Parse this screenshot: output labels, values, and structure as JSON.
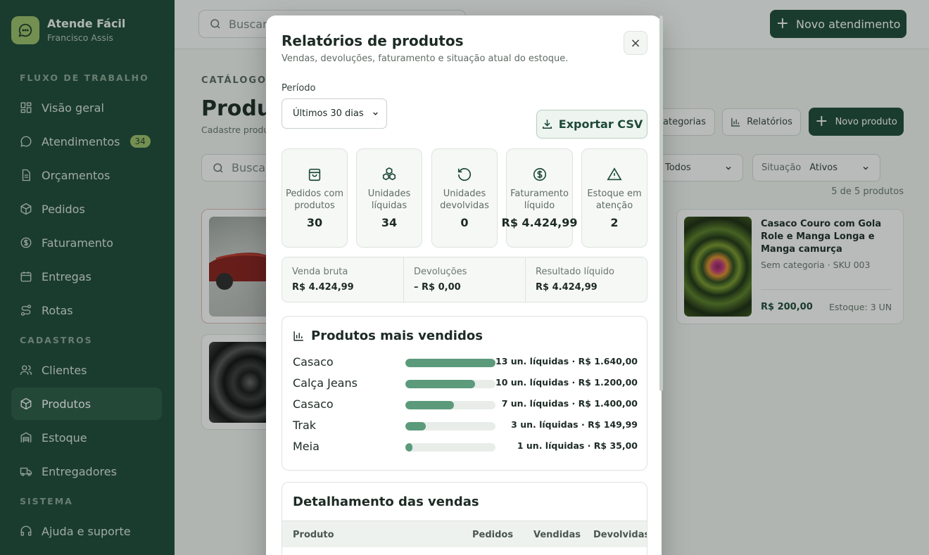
{
  "brand": {
    "name": "Atende Fácil",
    "user": "Francisco Assis"
  },
  "sidebar": {
    "section_flow": "FLUXO DE TRABALHO",
    "section_reg": "CADASTROS",
    "section_sys": "SISTEMA",
    "items": [
      {
        "label": "Visão geral",
        "icon": "grid-icon"
      },
      {
        "label": "Atendimentos",
        "icon": "chat-icon",
        "badge": "34"
      },
      {
        "label": "Orçamentos",
        "icon": "document-icon"
      },
      {
        "label": "Pedidos",
        "icon": "box-icon"
      },
      {
        "label": "Faturamento",
        "icon": "dollar-icon"
      },
      {
        "label": "Entregas",
        "icon": "calendar-icon"
      },
      {
        "label": "Rotas",
        "icon": "route-icon"
      },
      {
        "label": "Clientes",
        "icon": "users-icon"
      },
      {
        "label": "Produtos",
        "icon": "box-icon",
        "active": true
      },
      {
        "label": "Estoque",
        "icon": "warehouse-icon"
      },
      {
        "label": "Entregadores",
        "icon": "truck-icon"
      },
      {
        "label": "Ajuda e suporte",
        "icon": "headset-icon"
      }
    ]
  },
  "topbar": {
    "search_placeholder": "Buscar",
    "new_button": "Novo atendimento"
  },
  "page": {
    "crumb": "CATÁLOGO D",
    "title": "Produt",
    "subtitle": "Cadastre produ",
    "btn_categories": "categorias",
    "btn_reports": "Relatórios",
    "btn_new_product": "Novo produto",
    "search_placeholder": "Buscar",
    "filter_category_value": "Todos",
    "filter_status_label": "Situação",
    "filter_status_value": "Ativos",
    "count": "5 de 5 produtos"
  },
  "product_card": {
    "name": "Casaco Couro com Gola Role e Manga Longa e Manga camurça",
    "meta": "Sem categoria · SKU 003",
    "price": "R$ 200,00",
    "stock": "Estoque: 3 UN"
  },
  "modal": {
    "title": "Relatórios de produtos",
    "subtitle": "Vendas, devoluções, faturamento e situação atual do estoque.",
    "close": "×",
    "period_label": "Período",
    "period_value": "Últimos 30 dias",
    "export": "Exportar CSV",
    "kpis": [
      {
        "label": "Pedidos com produtos",
        "value": "30",
        "icon": "bag-icon"
      },
      {
        "label": "Unidades líquidas",
        "value": "34",
        "icon": "boxes-icon"
      },
      {
        "label": "Unidades devolvidas",
        "value": "0",
        "icon": "undo-icon"
      },
      {
        "label": "Faturamento líquido",
        "value": "R$ 4.424,99",
        "icon": "dollar-icon"
      },
      {
        "label": "Estoque em atenção",
        "value": "2",
        "icon": "warning-icon"
      }
    ],
    "summary": [
      {
        "label": "Venda bruta",
        "value": "R$ 4.424,99"
      },
      {
        "label": "Devoluções",
        "value": "– R$ 0,00"
      },
      {
        "label": "Resultado líquido",
        "value": "R$ 4.424,99"
      }
    ],
    "top_title": "Produtos mais vendidos",
    "top_products": [
      {
        "name": "Casaco",
        "stat": "13 un. líquidas · R$ 1.640,00",
        "fraction": 1.0
      },
      {
        "name": "Calça Jeans",
        "stat": "10 un. líquidas · R$ 1.200,00",
        "fraction": 0.77
      },
      {
        "name": "Casaco",
        "stat": "7 un. líquidas · R$ 1.400,00",
        "fraction": 0.54
      },
      {
        "name": "Trak",
        "stat": "3 un. líquidas · R$ 149,99",
        "fraction": 0.23
      },
      {
        "name": "Meia",
        "stat": "1 un. líquidas · R$ 35,00",
        "fraction": 0.08
      }
    ],
    "detail_title": "Detalhamento das vendas",
    "detail_columns": [
      "Produto",
      "Pedidos",
      "Vendidas",
      "Devolvidas"
    ]
  }
}
